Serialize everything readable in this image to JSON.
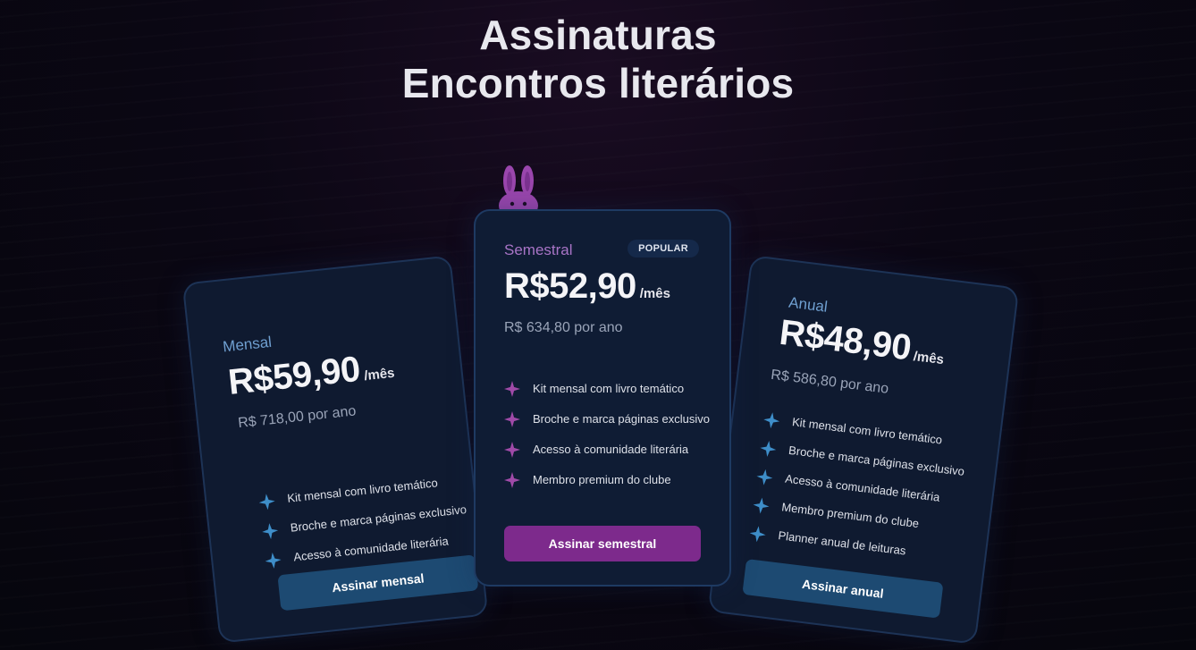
{
  "page": {
    "title_line1": "Assinaturas",
    "title_line2": "Encontros literários"
  },
  "colors": {
    "accent_purple": "#7d2a8c",
    "accent_blue": "#1d4a72",
    "star_blue": "#3e8ec9",
    "star_purple": "#a04aa8"
  },
  "plans": {
    "monthly": {
      "name": "Mensal",
      "price": "R$59,90",
      "per": "/mês",
      "yearly": "R$ 718,00 por ano",
      "features": [
        "Kit mensal com livro temático",
        "Broche e marca páginas exclusivo",
        "Acesso à comunidade literária"
      ],
      "button": "Assinar mensal",
      "icon": "sparkle-icon"
    },
    "semester": {
      "name": "Semestral",
      "badge": "POPULAR",
      "price": "R$52,90",
      "per": "/mês",
      "yearly": "R$ 634,80 por ano",
      "features": [
        "Kit mensal com livro temático",
        "Broche e marca páginas exclusivo",
        "Acesso à comunidade literária",
        "Membro premium do clube"
      ],
      "button": "Assinar semestral",
      "mascot": "bunny-icon"
    },
    "annual": {
      "name": "Anual",
      "price": "R$48,90",
      "per": "/mês",
      "yearly": "R$ 586,80 por ano",
      "features": [
        "Kit mensal com livro temático",
        "Broche e marca páginas exclusivo",
        "Acesso à comunidade literária",
        "Membro premium do clube",
        "Planner anual de leituras"
      ],
      "button": "Assinar anual"
    }
  }
}
